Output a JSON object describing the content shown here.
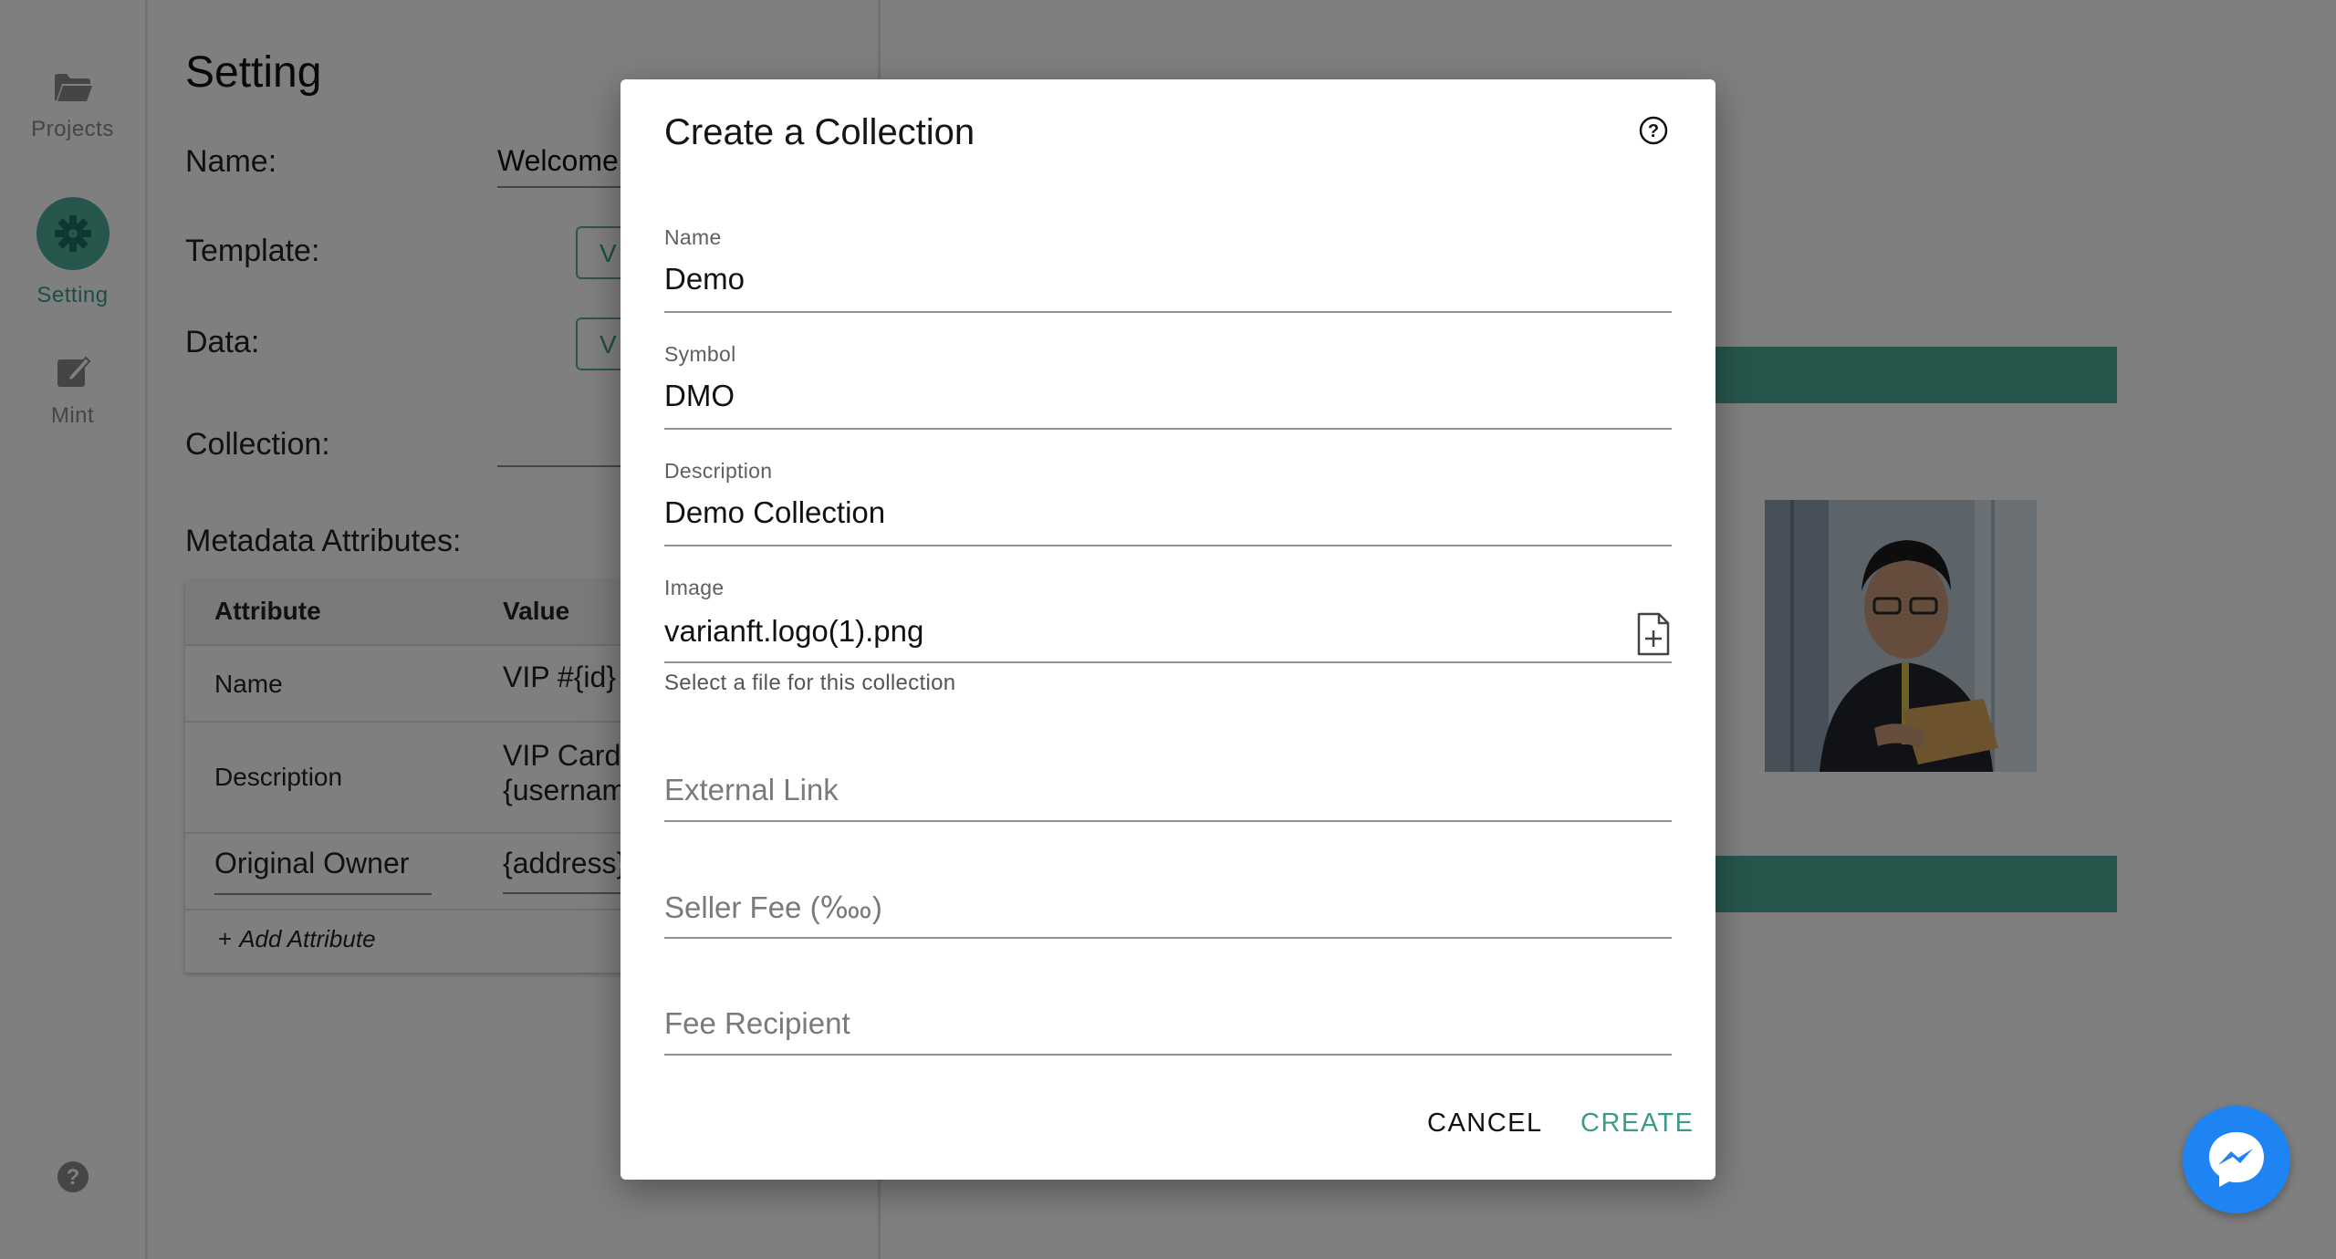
{
  "nav": {
    "items": [
      {
        "label": "Projects",
        "icon": "folder-icon"
      },
      {
        "label": "Setting",
        "icon": "gear-icon",
        "active": true
      },
      {
        "label": "Mint",
        "icon": "edit-icon"
      }
    ],
    "help_icon": "help-icon"
  },
  "settings": {
    "title": "Setting",
    "name_label": "Name:",
    "name_value": "Welcome",
    "template_label": "Template:",
    "template_button": "V",
    "data_label": "Data:",
    "data_button": "V",
    "collection_label": "Collection:",
    "metadata_label": "Metadata Attributes:",
    "table": {
      "headers": [
        "Attribute",
        "Value"
      ],
      "rows": [
        {
          "attribute": "Name",
          "value": "VIP #{id}"
        },
        {
          "attribute": "Description",
          "value_line1": "VIP Card",
          "value_line2": "{username}"
        },
        {
          "attribute": "Original Owner",
          "value": "{address}"
        }
      ],
      "add_label": "Add Attribute"
    }
  },
  "dialog": {
    "title": "Create a Collection",
    "fields": {
      "name": {
        "label": "Name",
        "value": "Demo"
      },
      "symbol": {
        "label": "Symbol",
        "value": "DMO"
      },
      "description": {
        "label": "Description",
        "value": "Demo Collection"
      },
      "image": {
        "label": "Image",
        "value": "varianft.logo(1).png",
        "helper": "Select a file for this collection"
      },
      "external_link": {
        "placeholder": "External Link"
      },
      "seller_fee": {
        "placeholder": "Seller Fee (‱)"
      },
      "fee_recipient": {
        "placeholder": "Fee Recipient"
      }
    },
    "cancel_label": "CANCEL",
    "create_label": "CREATE"
  },
  "colors": {
    "accent": "#3d9a8b",
    "brand_band": "#4caa98",
    "messenger": "#1f84f3"
  }
}
